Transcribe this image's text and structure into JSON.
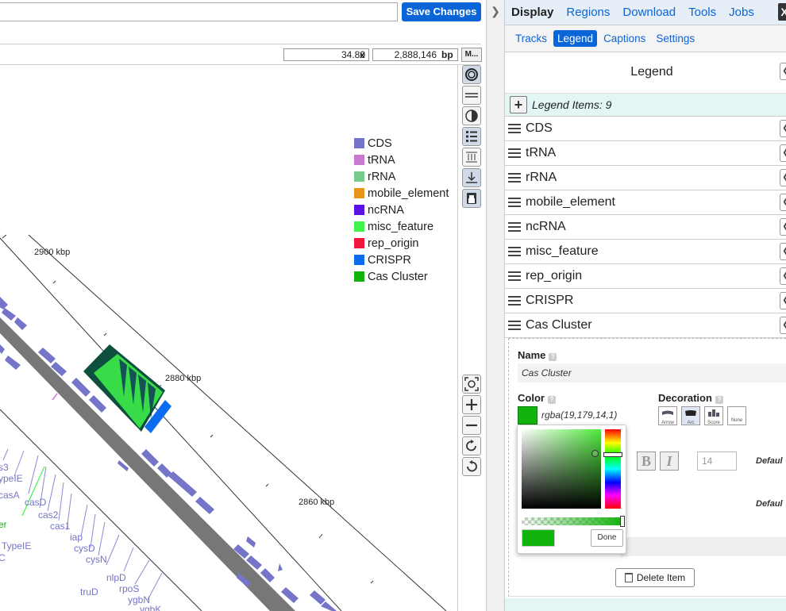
{
  "toolbar": {
    "save_label": "Save Changes"
  },
  "coords": {
    "zoom": "34.80",
    "zoom_unit": "x",
    "position": "2,888,146",
    "position_unit": "bp",
    "menu_label": "M..."
  },
  "colors": {
    "accent": "#0a65d8",
    "cas_cluster": "#13b30e"
  },
  "legend": {
    "items": [
      {
        "label": "CDS",
        "color": "#7474c8"
      },
      {
        "label": "tRNA",
        "color": "#c97ad0"
      },
      {
        "label": "rRNA",
        "color": "#77c98c"
      },
      {
        "label": "mobile_element",
        "color": "#e8941a"
      },
      {
        "label": "ncRNA",
        "color": "#5a12e6"
      },
      {
        "label": "misc_feature",
        "color": "#3ff34a"
      },
      {
        "label": "rep_origin",
        "color": "#f0163c"
      },
      {
        "label": "CRISPR",
        "color": "#0b6cf0"
      },
      {
        "label": "Cas Cluster",
        "color": "#13b30e"
      }
    ]
  },
  "map": {
    "ticks": [
      "2900 kbp",
      "2880 kbp",
      "2860 kbp"
    ],
    "genes": [
      "s3",
      "ypeIE",
      "casA",
      "casD",
      "cas2",
      "cas1",
      "er",
      "iap",
      "cysD",
      "TypeIE",
      "cysN",
      "C",
      "nlpD",
      "rpoS",
      "truD",
      "ygbN",
      "ygbK"
    ]
  },
  "tool_icons": [
    "ring-icon",
    "lines-icon",
    "contrast-icon",
    "list-icon",
    "track-spacing-icon",
    "anchor-icon",
    "lock-icon"
  ],
  "zoom_icons": [
    "fit-icon",
    "zoom-in-icon",
    "zoom-out-icon",
    "rotate-cw-icon",
    "rotate-ccw-icon"
  ],
  "panel": {
    "main_tabs": [
      "Display",
      "Regions",
      "Download",
      "Tools",
      "Jobs"
    ],
    "close": "X",
    "sub_tabs": [
      "Tracks",
      "Legend",
      "Captions",
      "Settings"
    ],
    "title": "Legend",
    "items_count": "Legend Items: 9",
    "rows": [
      "CDS",
      "tRNA",
      "rRNA",
      "mobile_element",
      "ncRNA",
      "misc_feature",
      "rep_origin",
      "CRISPR",
      "Cas Cluster"
    ],
    "detail": {
      "name_label": "Name",
      "name_value": "Cas Cluster",
      "color_label": "Color",
      "color_value": "rgba(19,179,14,1)",
      "decoration_label": "Decoration",
      "decorations": [
        "Arrow",
        "Arc",
        "Score",
        "None"
      ],
      "bold": "B",
      "italic": "I",
      "font_size": "14",
      "default1": "Defaul",
      "default2": "Defaul",
      "delete_label": "Delete Item"
    },
    "picker": {
      "done": "Done"
    }
  }
}
